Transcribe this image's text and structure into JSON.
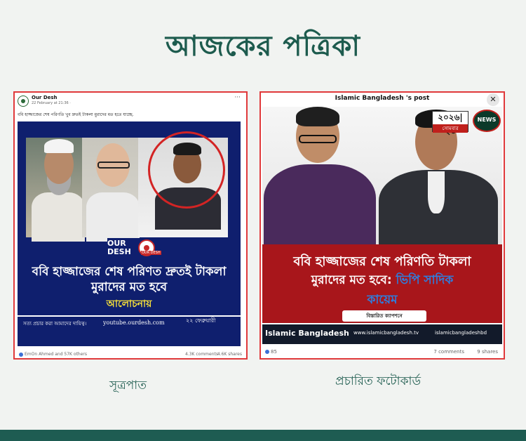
{
  "page": {
    "title": "আজকের পত্রিকা",
    "footer_color": "#1e5c52",
    "accent_color": "#1d5b4e"
  },
  "left_card": {
    "caption": "সূত্রপাত",
    "fb_post": {
      "page_name": "Our Desh",
      "timestamp": "22 February at 21:36 · ",
      "menu": "···",
      "post_text": "ববি হাজ্জাজের শেষ পরিণতি খুব দ্রুতই টাকলা মুরাদের মত হতে যাচ্ছে.",
      "logo_text": "OUR\nDESH",
      "logo_badge": "OUR DESH",
      "headline": "ববি হাজ্জাজের শেষ পরিণত দ্রুতই টাকলা মুরাদের মত হবে",
      "subheadline": "আলোচনায়",
      "slogan": "সত্য প্রচার করা আমাদের দায়িত্ব।",
      "youtube_url": "youtube.ourdesh.com",
      "date": "২২ ফেব্রুয়ারী",
      "reactions": "EmOn Ahmed and 57K others",
      "comments": "4.3K comments",
      "shares": "4.6K shares"
    }
  },
  "right_card": {
    "caption": "প্রচারিত ফটোকার্ড",
    "post": {
      "header_title": "Islamic Bangladesh 's post",
      "close_symbol": "✕",
      "date_badge_num": "২০২৬|২৩",
      "date_badge_day": "সোমবার",
      "news_logo": "NEWS",
      "headline_line1": "ববি হাজ্জাজের শেষ পরিণতি টাকলা",
      "headline_line2": "মুরাদের মত হবে:",
      "headline_line2_accent": "ভিপি সাদিক",
      "headline_line3": "কায়েম",
      "detail_button": "বিস্তারিত ক্যাপশনে",
      "brand_name": "Islamic Bangladesh",
      "brand_website": "www.islamicbangladesh.tv",
      "brand_youtube": "islamicbangladeshbd",
      "likes": "85",
      "comments": "7 comments",
      "shares": "9 shares"
    }
  }
}
